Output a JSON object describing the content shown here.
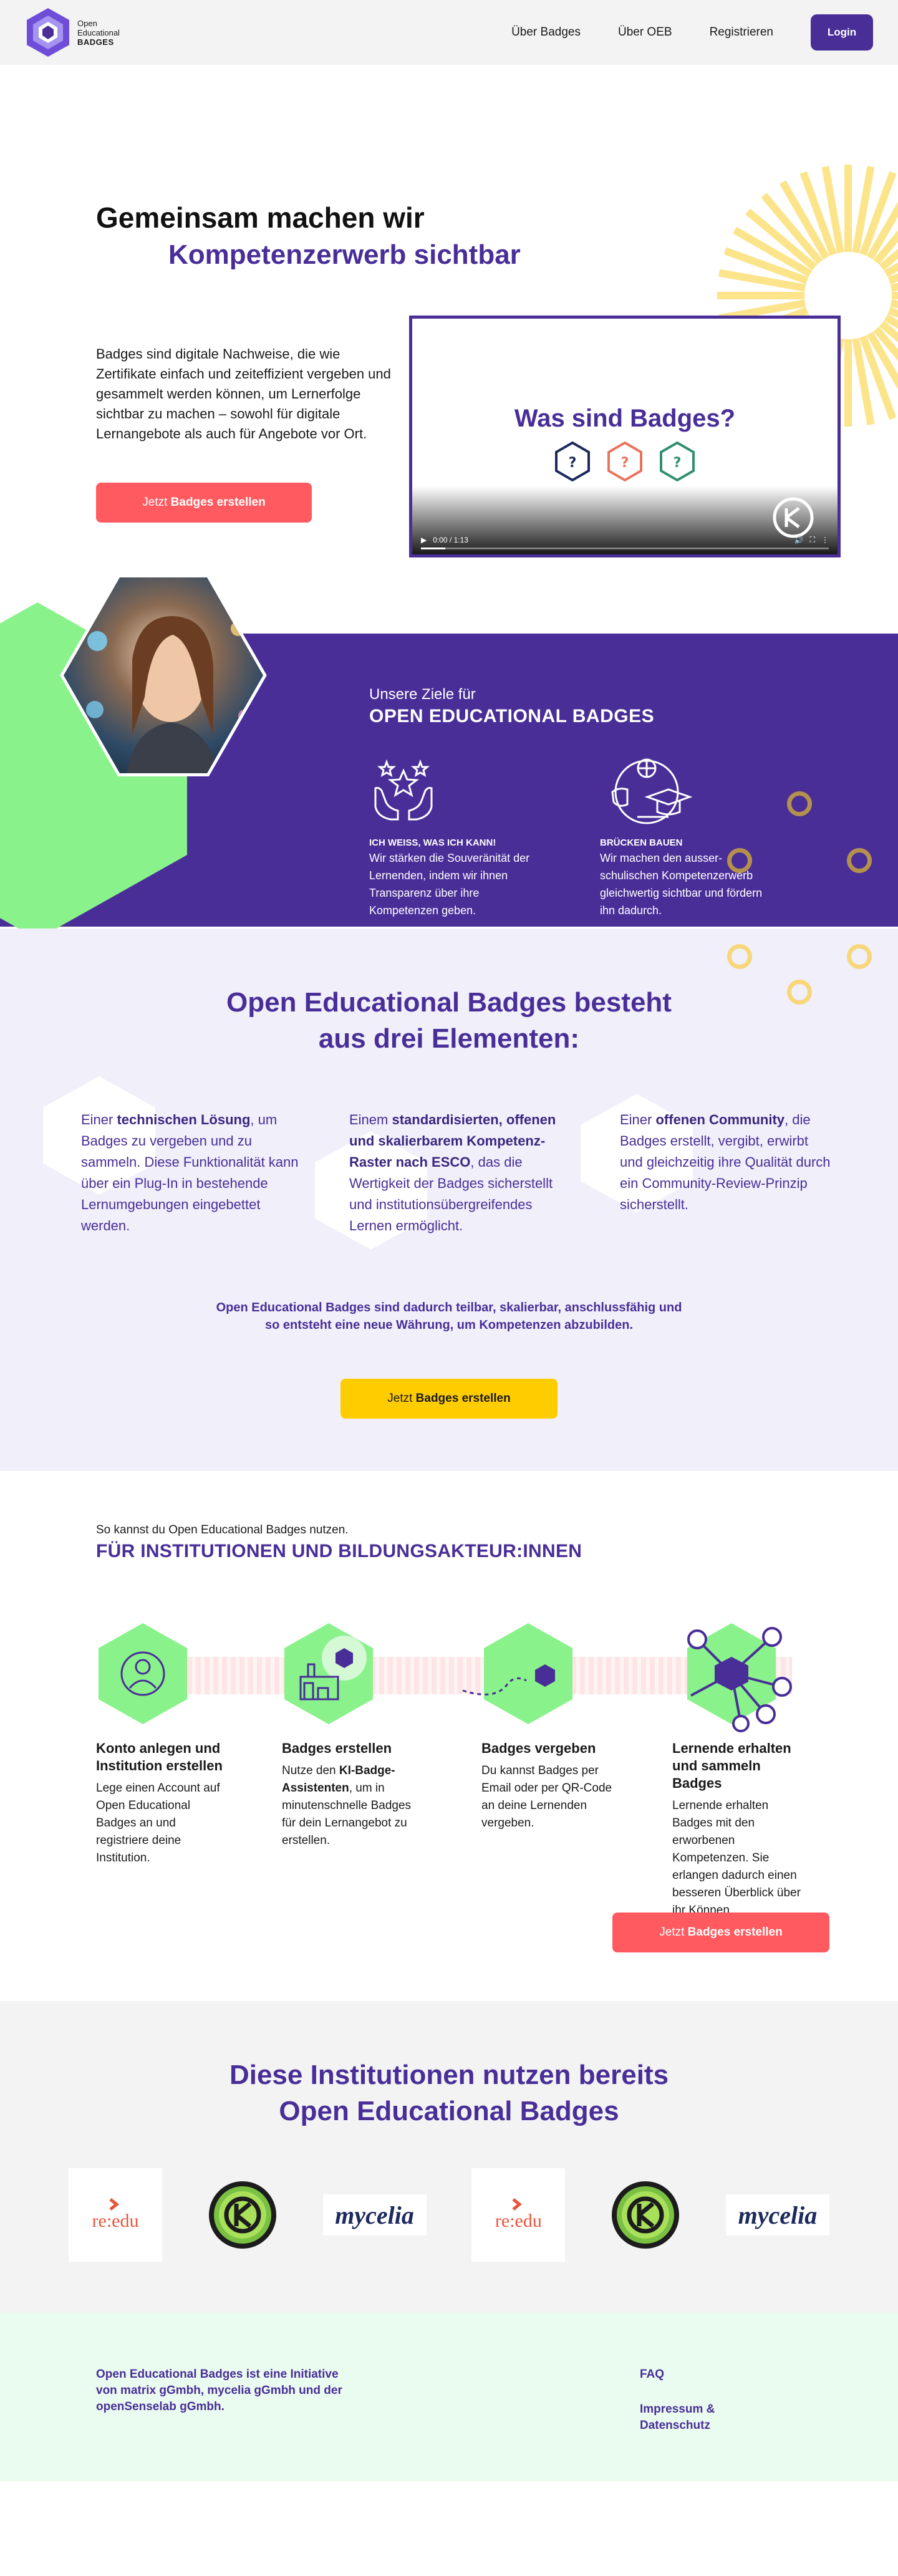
{
  "header": {
    "logo_lines": [
      "Open",
      "Educational",
      "BADGES"
    ],
    "nav": [
      "Über Badges",
      "Über OEB",
      "Registrieren"
    ],
    "login_label": "Login"
  },
  "hero": {
    "title_line_1": "Gemeinsam machen wir",
    "title_line_2": "Kompetenzerwerb sichtbar",
    "text": "Badges sind digitale Nachweise, die wie Zertifikate einfach und zeiteffizient vergeben und gesammelt werden können, um Lernerfolge sichtbar zu machen – sowohl für digitale Lernangebote als auch für Angebote vor Ort.",
    "cta_prefix": "Jetzt",
    "cta_strong": "Badges erstellen",
    "video": {
      "title": "Was sind Badges?",
      "hex_symbols": [
        "?",
        "?",
        "?"
      ],
      "time": "0:00 / 1:13",
      "progress": 0.06
    }
  },
  "goals": {
    "subtitle": "Unsere Ziele für",
    "title": "OPEN EDUCATIONAL BADGES",
    "items": [
      {
        "title": "ICH WEISS, WAS ICH KANN!",
        "text": "Wir stärken die Souveränität der Lernenden, indem wir ihnen Transparenz über ihre Kompetenzen geben."
      },
      {
        "title": "BRÜCKEN BAUEN",
        "text": "Wir machen den ausser-schulischen Kompetenzerwerb gleichwertig sichtbar und fördern ihn dadurch."
      }
    ]
  },
  "elements": {
    "title_line_1": "Open Educational Badges besteht",
    "title_line_2": "aus drei Elementen:",
    "col1": {
      "pre": "Einer ",
      "strong": "technischen Lösung",
      "post": ", um Badges zu vergeben und zu sammeln. Diese Funktionalität kann über ein Plug-In in bestehende Lernumgebungen eingebettet werden."
    },
    "col2": {
      "pre": "Einem ",
      "strong": "standardisierten, offenen und skalierbarem Kompetenz-Raster nach ESCO",
      "post": ", das die Wertigkeit der Badges sicherstellt und institutionsübergreifendes Lernen ermöglicht."
    },
    "col3": {
      "pre": "Einer ",
      "strong": "offenen Community",
      "post": ", die Badges erstellt, vergibt, erwirbt und gleichzeitig ihre Qualität durch ein Community-Review-Prinzip sicherstellt."
    },
    "summary_line_1": "Open Educational Badges sind dadurch teilbar, skalierbar, anschlussfähig und",
    "summary_line_2": "so entsteht eine neue Währung, um Kompetenzen abzubilden.",
    "cta_prefix": "Jetzt",
    "cta_strong": "Badges erstellen"
  },
  "howto": {
    "subtitle": "So kannst du Open Educational Badges nutzen.",
    "title": "FÜR INSTITUTIONEN UND BILDUNGSAKTEUR:INNEN",
    "steps": [
      {
        "title": "Konto anlegen und Institution erstellen",
        "text": "Lege einen Account auf Open Educational Badges an und registriere deine Institution."
      },
      {
        "title": "Badges erstellen",
        "text_pre": "Nutze den ",
        "text_strong": "KI-Badge-Assistenten",
        "text_post": ", um in minutenschnelle Badges für dein Lernangebot zu erstellen."
      },
      {
        "title": "Badges vergeben",
        "text": "Du kannst Badges per Email oder per QR-Code an deine Lernenden vergeben."
      },
      {
        "title": "Lernende erhalten und sammeln Badges",
        "text": "Lernende erhalten Badges mit den erworbenen Kompetenzen. Sie erlangen dadurch einen besseren Überblick über ihr Können."
      }
    ],
    "cta_prefix": "Jetzt",
    "cta_strong": "Badges erstellen"
  },
  "institutions": {
    "title_line_1": "Diese Institutionen nutzen bereits",
    "title_line_2": "Open Educational Badges",
    "logos": [
      "re:edu",
      "openSenselab",
      "mycelia",
      "re:edu",
      "openSenselab",
      "mycelia"
    ]
  },
  "footer": {
    "text": "Open Educational Badges ist eine Initiative von matrix gGmbh, mycelia gGmbh und der openSenselab gGmbh.",
    "links": [
      "FAQ",
      "Impressum & Datenschutz"
    ]
  },
  "colors": {
    "brand_purple": "#492e98",
    "accent_red": "#ff5a5f",
    "accent_yellow": "#ffcc00",
    "accent_green": "#8af28a",
    "section_lavender": "#f0effa",
    "footer_mint": "#eafbef"
  }
}
